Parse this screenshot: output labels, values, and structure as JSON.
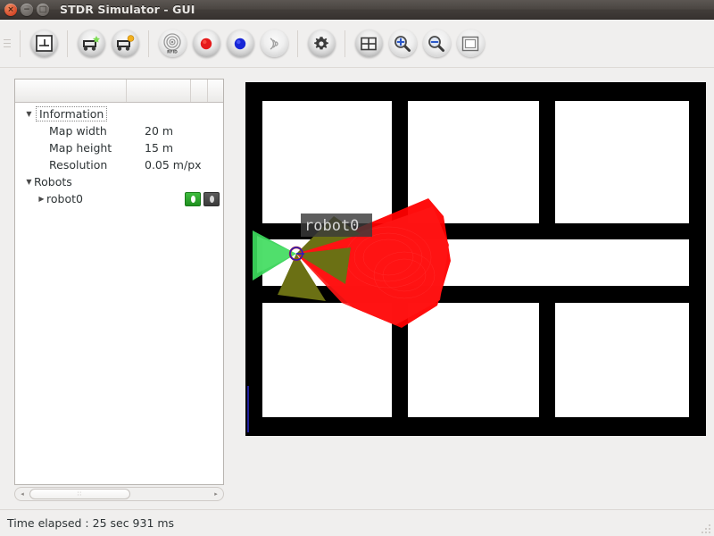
{
  "window": {
    "title": "STDR Simulator - GUI",
    "buttons": [
      {
        "name": "close",
        "glyph": "×"
      },
      {
        "name": "minimize",
        "glyph": "−"
      },
      {
        "name": "maximize",
        "glyph": "□"
      }
    ]
  },
  "toolbar": {
    "items": [
      {
        "name": "load-map-button",
        "icon": "map-icon",
        "tooltip": "Load map"
      },
      {
        "name": "add-robot-button",
        "icon": "add-robot-icon",
        "tooltip": "Create robot"
      },
      {
        "name": "load-robot-button",
        "icon": "load-robot-icon",
        "tooltip": "Load robot"
      },
      {
        "name": "add-rfid-button",
        "icon": "rfid-icon",
        "tooltip": "Add RFID tag"
      },
      {
        "name": "add-co2-button",
        "icon": "co2-source-icon",
        "tooltip": "Add CO2 source"
      },
      {
        "name": "add-sound-button",
        "icon": "sound-source-icon",
        "tooltip": "Add sound source"
      },
      {
        "name": "add-thermal-button",
        "icon": "thermal-source-icon",
        "tooltip": "Add thermal source"
      },
      {
        "name": "properties-button",
        "icon": "gear-icon",
        "tooltip": "Properties"
      },
      {
        "name": "grid-button",
        "icon": "grid-icon",
        "tooltip": "Toggle grid"
      },
      {
        "name": "zoom-in-button",
        "icon": "zoom-in-icon",
        "tooltip": "Zoom in"
      },
      {
        "name": "zoom-out-button",
        "icon": "zoom-out-icon",
        "tooltip": "Zoom out"
      },
      {
        "name": "adjust-view-button",
        "icon": "fit-window-icon",
        "tooltip": "Adjust visualization"
      }
    ]
  },
  "tree": {
    "columns": [
      "",
      "",
      "",
      ""
    ],
    "nodes": [
      {
        "label": "Information",
        "expander": "▼",
        "focused": true
      },
      {
        "key": "Map width",
        "value": "20 m"
      },
      {
        "key": "Map height",
        "value": "15 m"
      },
      {
        "key": "Resolution",
        "value": "0.05 m/px"
      },
      {
        "label": "Robots",
        "expander": "▼",
        "focused": false
      },
      {
        "label": "robot0",
        "expander": "▶",
        "focused": false,
        "child": true,
        "icons": [
          "visibility-on-icon",
          "visibility-off-icon"
        ]
      }
    ]
  },
  "scrollbar": {
    "left_arrow": "◂",
    "right_arrow": "▸",
    "grip": "∶∶"
  },
  "map": {
    "robot_label": "robot0",
    "colors": {
      "wall": "#000000",
      "free": "#ffffff",
      "laser": "#ff0000",
      "sonar_near": "#33d44d",
      "sonar_far": "#6b7014",
      "robot_body": "#2020c0",
      "robot_dir": "#d02020",
      "label_bg": "#3a3a3a",
      "label_text": "#d8d8d8"
    }
  },
  "status": {
    "text": "Time elapsed : 25 sec 931 ms"
  }
}
